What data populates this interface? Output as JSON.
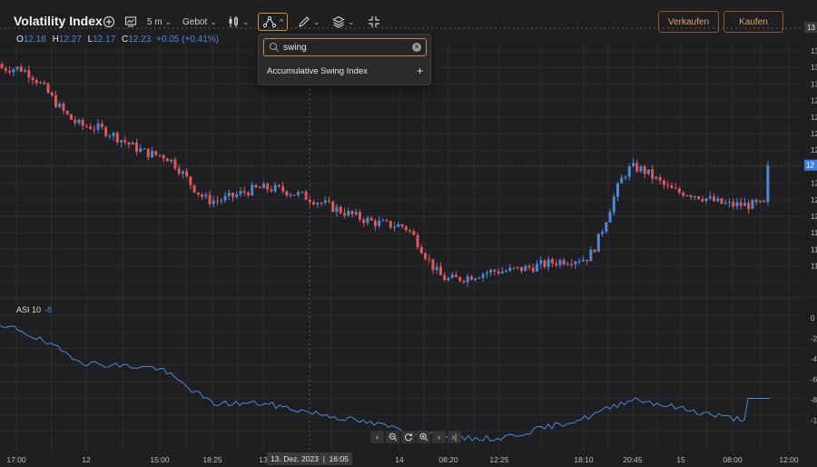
{
  "toolbar": {
    "title": "Volatility Index",
    "interval": "5 m",
    "price_type": "Gebot",
    "sell_label": "Verkaufen",
    "buy_label": "Kaufen"
  },
  "ohlc": {
    "o_label": "O",
    "o": "12.18",
    "h_label": "H",
    "h": "12.27",
    "l_label": "L",
    "l": "12.17",
    "c_label": "C",
    "c": "12.23",
    "change": "+0.05 (+0.41%)"
  },
  "indicator_search": {
    "query": "swing",
    "results": [
      "Accumulative Swing Index"
    ]
  },
  "asi": {
    "label": "ASI 10",
    "value": "-8"
  },
  "x_axis": [
    "17:00",
    "12",
    "15:00",
    "18:25",
    "13",
    "14",
    "08:20",
    "12:25",
    "18:10",
    "20:45",
    "15",
    "08:00",
    "12:00"
  ],
  "crosshair": {
    "date": "13. Dez. 2023",
    "time": "16:05"
  },
  "colors": {
    "up": "#4c88d8",
    "down": "#e0575c",
    "accent": "#d98b3a",
    "background": "#1f1f22"
  },
  "chart_data": [
    {
      "type": "candlestick",
      "title": "Volatility Index",
      "xlabel": "",
      "ylabel": "",
      "x": [
        "17:00",
        "12",
        "15:00",
        "18:25",
        "13",
        "14",
        "08:20",
        "12:25",
        "18:10",
        "20:45",
        "15",
        "08:00"
      ],
      "close_trend": [
        13.4,
        12.7,
        12.35,
        11.8,
        11.95,
        11.5,
        10.85,
        10.95,
        11.1,
        12.2,
        11.9,
        11.75
      ],
      "last": 12.23
    },
    {
      "type": "line",
      "title": "ASI 10",
      "xlabel": "",
      "ylabel": "",
      "y_ticks": [
        "0",
        "-2",
        "-4",
        "-6",
        "-8",
        "-1"
      ],
      "x": [
        "17:00",
        "12",
        "15:00",
        "18:25",
        "13",
        "14",
        "08:20",
        "12:25",
        "18:10",
        "20:45",
        "15",
        "08:00"
      ],
      "values": [
        -1,
        -4.5,
        -5,
        -8.5,
        -8.5,
        -11,
        -12,
        -12,
        -10,
        -8,
        -9,
        -10
      ],
      "last": -8
    }
  ]
}
